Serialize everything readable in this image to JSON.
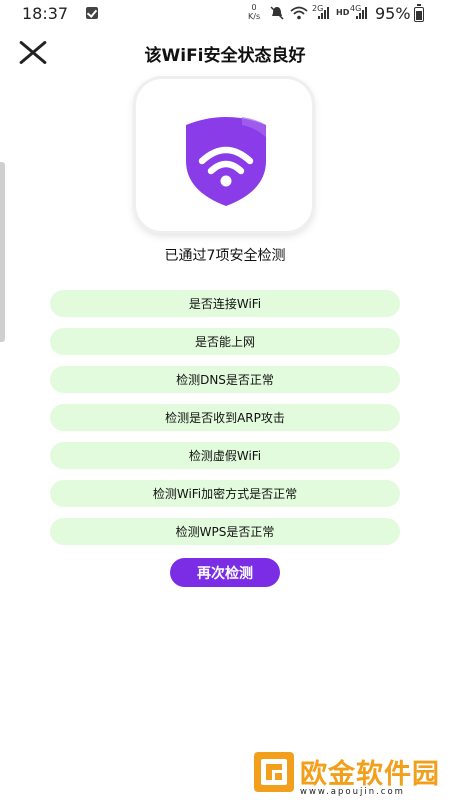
{
  "status_bar": {
    "time": "18:37",
    "speed_value": "0",
    "speed_unit": "K/s",
    "network_2g": "2G",
    "hd": "HD",
    "network_4g": "4G",
    "battery": "95%"
  },
  "header": {
    "title": "该WiFi安全状态良好"
  },
  "result": {
    "summary": "已通过7项安全检测"
  },
  "checks": [
    "是否连接WiFi",
    "是否能上网",
    "检测DNS是否正常",
    "检测是否收到ARP攻击",
    "检测虚假WiFi",
    "检测WiFi加密方式是否正常",
    "检测WPS是否正常"
  ],
  "actions": {
    "recheck": "再次检测"
  },
  "watermark": {
    "name": "欧金软件园",
    "url": "www.apoujin.com"
  },
  "colors": {
    "accent": "#7b2de6",
    "shield": "#8a3ce8",
    "check_bg": "#e1fbdc",
    "watermark": "#f2a01c"
  },
  "icons": [
    "close-icon",
    "shield-wifi-icon",
    "battery-icon",
    "wifi-icon",
    "mute-icon"
  ]
}
